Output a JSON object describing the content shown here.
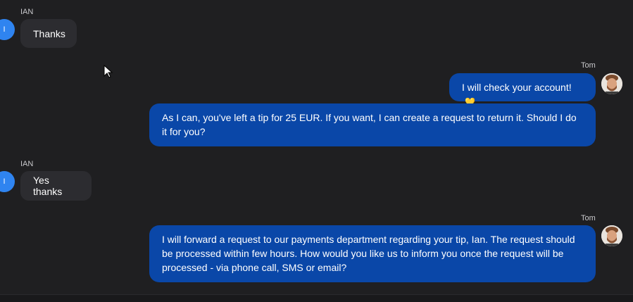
{
  "messages": [
    {
      "sender": "IAN",
      "avatar_letter": "I",
      "text": "Thanks"
    },
    {
      "sender": "Tom",
      "text": "I will check your account!",
      "emoji": "💛"
    },
    {
      "text": "As I can, you've left a tip for 25 EUR. If you want, I can create a request to return it. Should I do it for you?"
    },
    {
      "sender": "IAN",
      "avatar_letter": "I",
      "text": "Yes thanks"
    },
    {
      "sender": "Tom",
      "text": "I will forward a request to our payments department regarding your tip, Ian. The request should be processed within few hours. How would you like us to inform you once the request will be processed - via phone call, SMS or email?"
    }
  ],
  "colors": {
    "background": "#1f1f21",
    "incoming_bubble": "#2c2c30",
    "outgoing_bubble": "#0a47a8",
    "user_avatar": "#2f84f0"
  }
}
